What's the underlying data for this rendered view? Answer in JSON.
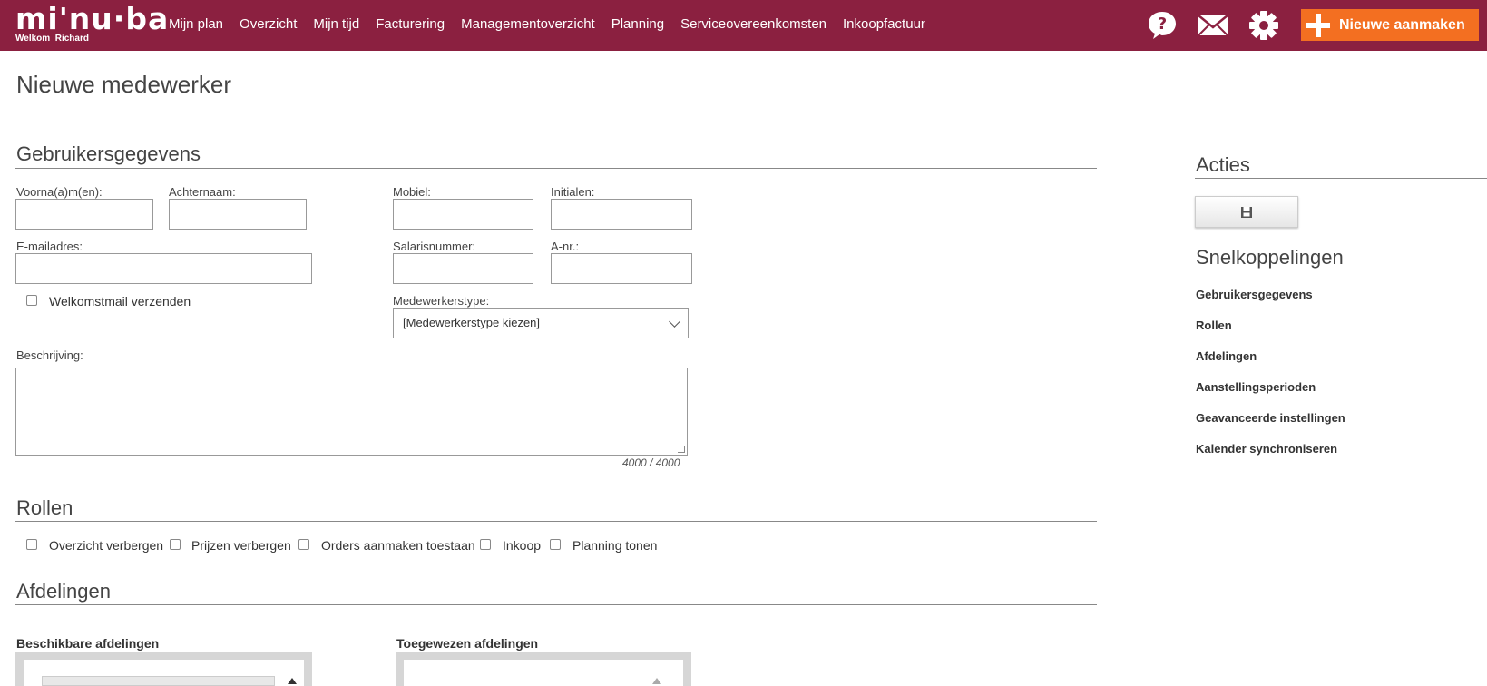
{
  "header": {
    "logo": "mi'nu·ba",
    "welcome": "Welkom  Richard",
    "nav": [
      "Mijn plan",
      "Overzicht",
      "Mijn tijd",
      "Facturering",
      "Managementoverzicht",
      "Planning",
      "Serviceovereenkomsten",
      "Inkoopfactuur"
    ],
    "new_button": "Nieuwe aanmaken"
  },
  "page": {
    "title": "Nieuwe medewerker"
  },
  "user_data": {
    "title": "Gebruikersgegevens",
    "first_name_label": "Voorna(a)m(en):",
    "last_name_label": "Achternaam:",
    "mobile_label": "Mobiel:",
    "initials_label": "Initialen:",
    "email_label": "E-mailadres:",
    "salary_label": "Salarisnummer:",
    "anr_label": "A-nr.:",
    "welcome_mail_label": "Welkomstmail verzenden",
    "type_label": "Medewerkerstype:",
    "type_value": "[Medewerkerstype kiezen]",
    "description_label": "Beschrijving:",
    "counter": "4000 / 4000"
  },
  "roles": {
    "title": "Rollen",
    "items": [
      "Overzicht verbergen",
      "Prijzen verbergen",
      "Orders aanmaken toestaan",
      "Inkoop",
      "Planning tonen"
    ]
  },
  "departments": {
    "title": "Afdelingen",
    "available": "Beschikbare afdelingen",
    "assigned": "Toegewezen afdelingen"
  },
  "sidebar": {
    "actions_title": "Acties",
    "quick_title": "Snelkoppelingen",
    "links": [
      "Gebruikersgegevens",
      "Rollen",
      "Afdelingen",
      "Aanstellingsperioden",
      "Geavanceerde instellingen",
      "Kalender synchroniseren"
    ]
  },
  "colors": {
    "header": "#8b2040",
    "accent": "#f36f21"
  }
}
